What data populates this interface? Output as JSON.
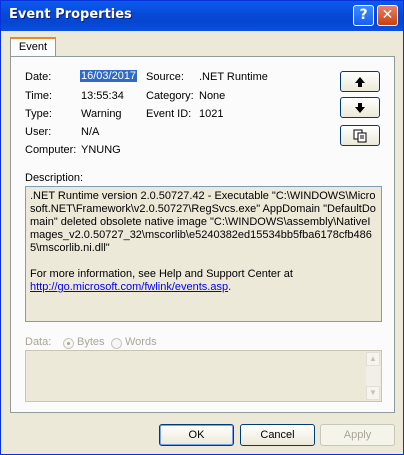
{
  "window": {
    "title": "Event Properties",
    "help_label": "?",
    "close_label": "✕"
  },
  "tabs": [
    {
      "label": "Event"
    }
  ],
  "fields": {
    "date_label": "Date:",
    "date_value": "16/03/2017",
    "time_label": "Time:",
    "time_value": "13:55:34",
    "type_label": "Type:",
    "type_value": "Warning",
    "user_label": "User:",
    "user_value": "N/A",
    "computer_label": "Computer:",
    "computer_value": "YNUNG",
    "source_label": "Source:",
    "source_value": ".NET Runtime",
    "category_label": "Category:",
    "category_value": "None",
    "eventid_label": "Event ID:",
    "eventid_value": "1021"
  },
  "side_buttons": {
    "up_icon": "up-arrow-icon",
    "down_icon": "down-arrow-icon",
    "copy_icon": "copy-icon"
  },
  "description": {
    "label": "Description:",
    "text": ".NET Runtime version 2.0.50727.42 - Executable \"C:\\WINDOWS\\Microsoft.NET\\Framework\\v2.0.50727\\RegSvcs.exe\" AppDomain \"DefaultDomain\" deleted obsolete native image \"C:\\WINDOWS\\assembly\\NativeImages_v2.0.50727_32\\mscorlib\\e5240382ed15534bb5fba6178cfb4865\\mscorlib.ni.dll\"",
    "help_text": "For more information, see Help and Support Center at",
    "link": "http://go.microsoft.com/fwlink/events.asp",
    "link_suffix": "."
  },
  "data_section": {
    "label": "Data:",
    "bytes_label": "Bytes",
    "words_label": "Words",
    "selected": "Bytes"
  },
  "buttons": {
    "ok": "OK",
    "cancel": "Cancel",
    "apply": "Apply"
  },
  "colors": {
    "title_bar": "#0a5bf0",
    "selection": "#316ac5",
    "link": "#0000ee",
    "dialog_bg": "#ece9d8"
  }
}
